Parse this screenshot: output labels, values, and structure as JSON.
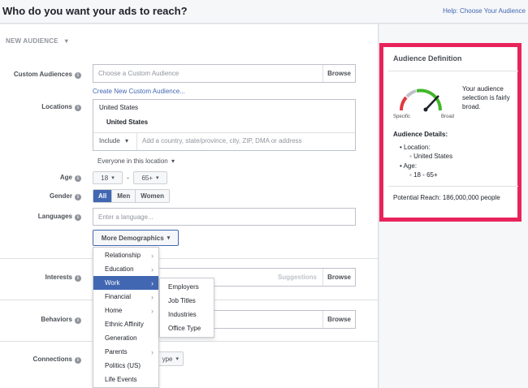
{
  "header": {
    "title": "Who do you want your ads to reach?",
    "help_link": "Help: Choose Your Audience"
  },
  "new_audience": {
    "label": "NEW AUDIENCE"
  },
  "custom_audiences": {
    "label": "Custom Audiences",
    "placeholder": "Choose a Custom Audience",
    "browse": "Browse",
    "create_link": "Create New Custom Audience..."
  },
  "locations": {
    "label": "Locations",
    "country_header": "United States",
    "country_selected": "United States",
    "include_label": "Include",
    "placeholder": "Add a country, state/province, city, ZIP, DMA or address",
    "everyone_label": "Everyone in this location"
  },
  "age": {
    "label": "Age",
    "min": "18",
    "max": "65+",
    "dash": "-"
  },
  "gender": {
    "label": "Gender",
    "options": [
      "All",
      "Men",
      "Women"
    ],
    "selected": "All"
  },
  "languages": {
    "label": "Languages",
    "placeholder": "Enter a language..."
  },
  "more_demographics": {
    "label": "More Demographics"
  },
  "interests": {
    "label": "Interests",
    "suggestions": "Suggestions",
    "browse": "Browse"
  },
  "behaviors": {
    "label": "Behaviors",
    "browse": "Browse"
  },
  "connections": {
    "label": "Connections",
    "type_fragment": "ype"
  },
  "demographics_menu": {
    "items": [
      {
        "label": "Relationship",
        "chevron": true
      },
      {
        "label": "Education",
        "chevron": true
      },
      {
        "label": "Work",
        "chevron": true,
        "active": true
      },
      {
        "label": "Financial",
        "chevron": true
      },
      {
        "label": "Home",
        "chevron": true
      },
      {
        "label": "Ethnic Affinity",
        "chevron": false
      },
      {
        "label": "Generation",
        "chevron": false
      },
      {
        "label": "Parents",
        "chevron": true
      },
      {
        "label": "Politics (US)",
        "chevron": false
      },
      {
        "label": "Life Events",
        "chevron": false
      }
    ]
  },
  "work_submenu": {
    "items": [
      "Employers",
      "Job Titles",
      "Industries",
      "Office Type"
    ]
  },
  "audience_definition": {
    "title": "Audience Definition",
    "gauge_text": "Your audience selection is fairly broad.",
    "specific": "Specific",
    "broad": "Broad",
    "details_title": "Audience Details:",
    "location_label": "Location:",
    "location_value": "United States",
    "age_label": "Age:",
    "age_value": "18 - 65+",
    "potential_reach": "Potential Reach: 186,000,000 people"
  },
  "colors": {
    "highlight_border": "#e8235b",
    "accent_blue": "#4267b2",
    "gauge_red": "#e0393e",
    "gauge_green": "#42b72a"
  }
}
